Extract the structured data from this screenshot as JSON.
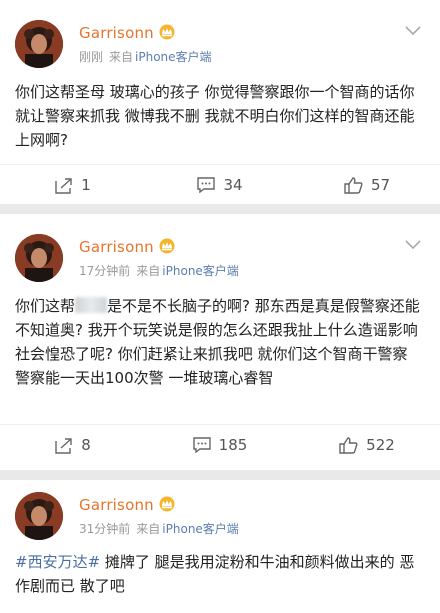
{
  "colors": {
    "username": "#e8742b",
    "source_app": "#5b7db2",
    "hashtag": "#4a6fa6",
    "meta_gray": "#999999",
    "background": "#e9e9e9"
  },
  "posts": [
    {
      "author": "Garrisonn",
      "badge_icon": "vip-crown-icon",
      "time": "刚刚",
      "source_prefix": "来自",
      "source_app": "iPhone客户端",
      "text": "你们这帮圣母 玻璃心的孩子 你觉得警察跟你一个智商的话你就让警察来抓我 微博我不删 我就不明白你们这样的智商还能上网啊?",
      "reposts": "1",
      "comments": "34",
      "likes": "57"
    },
    {
      "author": "Garrisonn",
      "badge_icon": "vip-crown-icon",
      "time": "17分钟前",
      "source_prefix": "来自",
      "source_app": "iPhone客户端",
      "text_before_blur": "你们这帮",
      "text_after_blur": "是不是不长脑子的啊? 那东西是真是假警察还能不知道奥? 我开个玩笑说是假的怎么还跟我扯上什么造谣影响社会惶恐了呢? 你们赶紧让来抓我吧 就你们这个智商干警察 警察能一天出100次警 一堆玻璃心睿智",
      "reposts": "8",
      "comments": "185",
      "likes": "522"
    },
    {
      "author": "Garrisonn",
      "badge_icon": "vip-crown-icon",
      "time": "31分钟前",
      "source_prefix": "来自",
      "source_app": "iPhone客户端",
      "hashtag": "#西安万达#",
      "text": " 摊牌了 腿是我用淀粉和牛油和颜料做出来的 恶作剧而已 散了吧"
    }
  ]
}
